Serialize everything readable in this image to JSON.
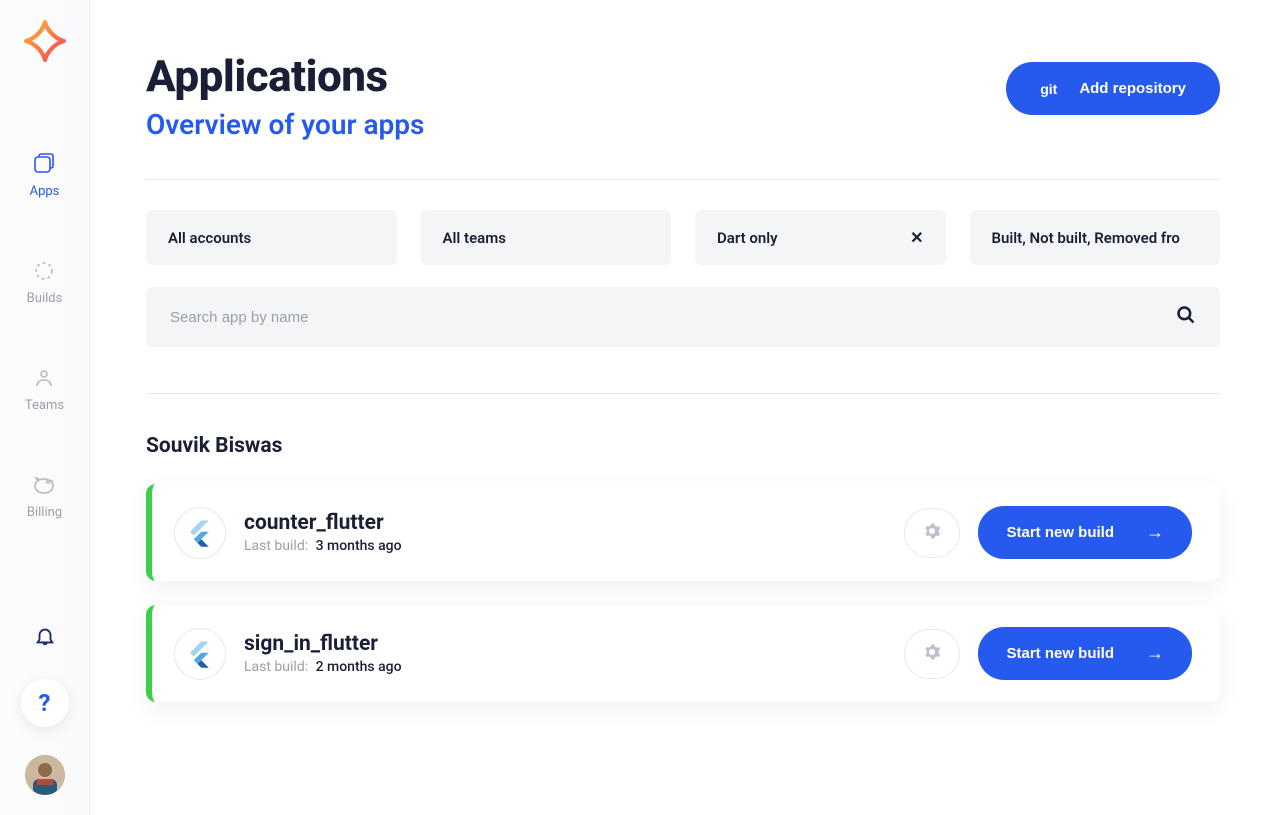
{
  "sidebar": {
    "items": [
      {
        "label": "Apps"
      },
      {
        "label": "Builds"
      },
      {
        "label": "Teams"
      },
      {
        "label": "Billing"
      }
    ],
    "help": "?"
  },
  "header": {
    "title": "Applications",
    "subtitle": "Overview of your apps",
    "add_repo_prefix": "git",
    "add_repo_label": "Add repository"
  },
  "filters": {
    "accounts": "All accounts",
    "teams": "All teams",
    "platform": "Dart only",
    "status": "Built, Not built, Removed fro"
  },
  "search": {
    "placeholder": "Search app by name"
  },
  "owner": "Souvik Biswas",
  "apps": [
    {
      "name": "counter_flutter",
      "last_build_label": "Last build:",
      "last_build_when": "3 months ago",
      "button": "Start new build"
    },
    {
      "name": "sign_in_flutter",
      "last_build_label": "Last build:",
      "last_build_when": "2 months ago",
      "button": "Start new build"
    }
  ]
}
